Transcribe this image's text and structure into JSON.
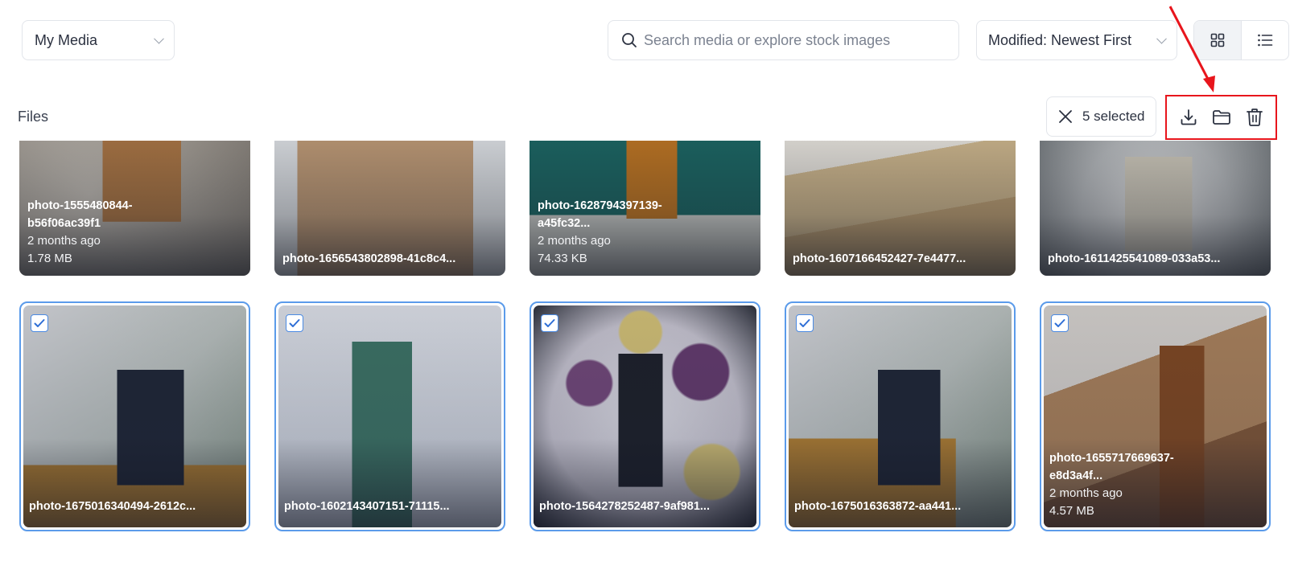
{
  "toolbar": {
    "media_source": "My Media",
    "search_placeholder": "Search media or explore stock images",
    "sort": "Modified: Newest First",
    "view_modes": [
      "grid-icon",
      "list-icon"
    ],
    "active_view": "grid"
  },
  "files": {
    "label": "Files",
    "selected_text": "5 selected",
    "actions": [
      "download-icon",
      "folder-icon",
      "trash-icon"
    ]
  },
  "grid": {
    "row1": [
      {
        "name": "photo-1555480844-\nb56f06ac39f1",
        "age": "2 months ago",
        "size": "1.78 MB"
      },
      {
        "name": "photo-1656543802898-41c8c4..."
      },
      {
        "name": "photo-1628794397139-\na45fc32...",
        "age": "2 months ago",
        "size": "74.33 KB"
      },
      {
        "name": "photo-1607166452427-7e4477..."
      },
      {
        "name": "photo-1611425541089-033a53..."
      }
    ],
    "row2": [
      {
        "name": "photo-1675016340494-2612c...",
        "selected": true
      },
      {
        "name": "photo-1602143407151-71115...",
        "selected": true
      },
      {
        "name": "photo-1564278252487-9af981...",
        "selected": true
      },
      {
        "name": "photo-1675016363872-aa441...",
        "selected": true
      },
      {
        "name": "photo-1655717669637-\ne8d3a4f...",
        "age": "2 months ago",
        "size": "4.57 MB",
        "selected": true
      }
    ]
  },
  "colors": {
    "selection_border": "#5b9bea",
    "annotation_red": "#e8151c"
  }
}
